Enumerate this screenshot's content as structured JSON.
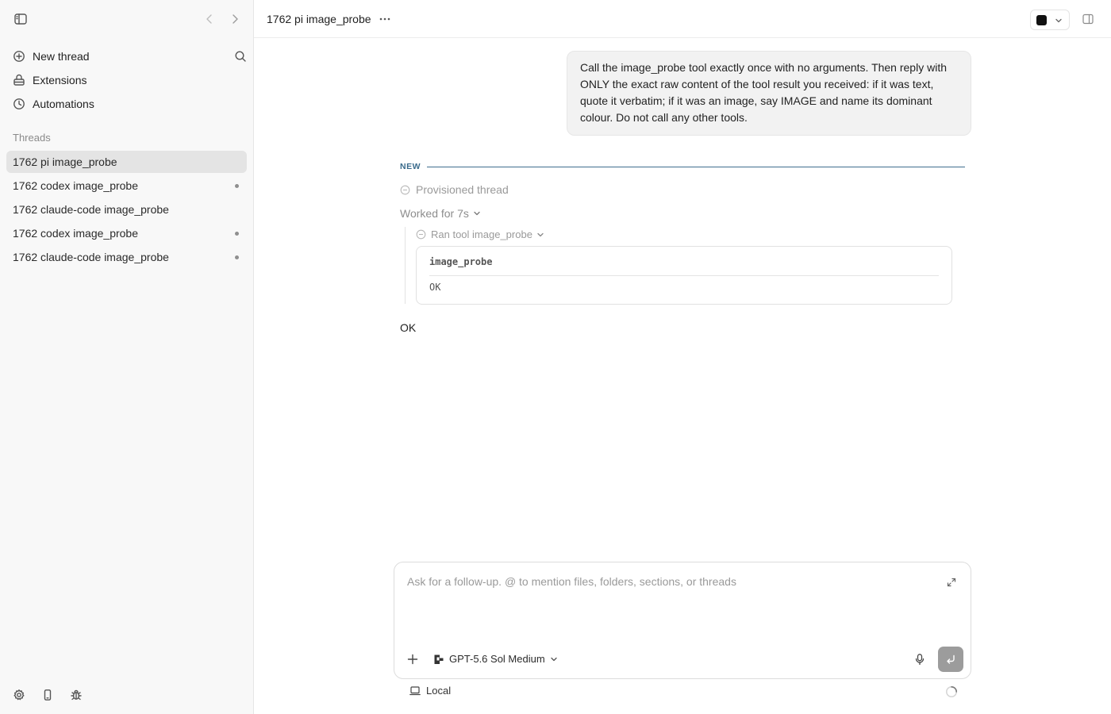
{
  "sidebar": {
    "menu": [
      {
        "label": "New thread",
        "icon": "plus-circle-icon"
      },
      {
        "label": "Extensions",
        "icon": "extensions-icon"
      },
      {
        "label": "Automations",
        "icon": "clock-icon"
      }
    ],
    "threads_heading": "Threads",
    "threads": [
      {
        "title": "1762 pi image_probe",
        "active": true,
        "unread": false
      },
      {
        "title": "1762 codex image_probe",
        "active": false,
        "unread": true
      },
      {
        "title": "1762 claude-code image_probe",
        "active": false,
        "unread": false
      },
      {
        "title": "1762 codex image_probe",
        "active": false,
        "unread": true
      },
      {
        "title": "1762 claude-code image_probe",
        "active": false,
        "unread": true
      }
    ]
  },
  "header": {
    "title": "1762 pi image_probe"
  },
  "chat": {
    "user_message": "Call the image_probe tool exactly once with no arguments. Then reply with ONLY the exact raw content of the tool result you received: if it was text, quote it verbatim; if it was an image, say IMAGE and name its dominant colour. Do not call any other tools.",
    "new_label": "NEW",
    "provisioned": "Provisioned thread",
    "worked_for": "Worked for 7s",
    "ran_tool": "Ran tool image_probe",
    "tool_name": "image_probe",
    "tool_output": "OK",
    "reply": "OK"
  },
  "composer": {
    "placeholder": "Ask for a follow-up. @ to mention files, folders, sections, or threads",
    "model": "GPT-5.6 Sol Medium",
    "environment": "Local"
  },
  "colors": {
    "accent_divider": "#3f6e8e",
    "active_thread_bg": "#e4e4e4",
    "send_button": "#9c9c9c"
  }
}
